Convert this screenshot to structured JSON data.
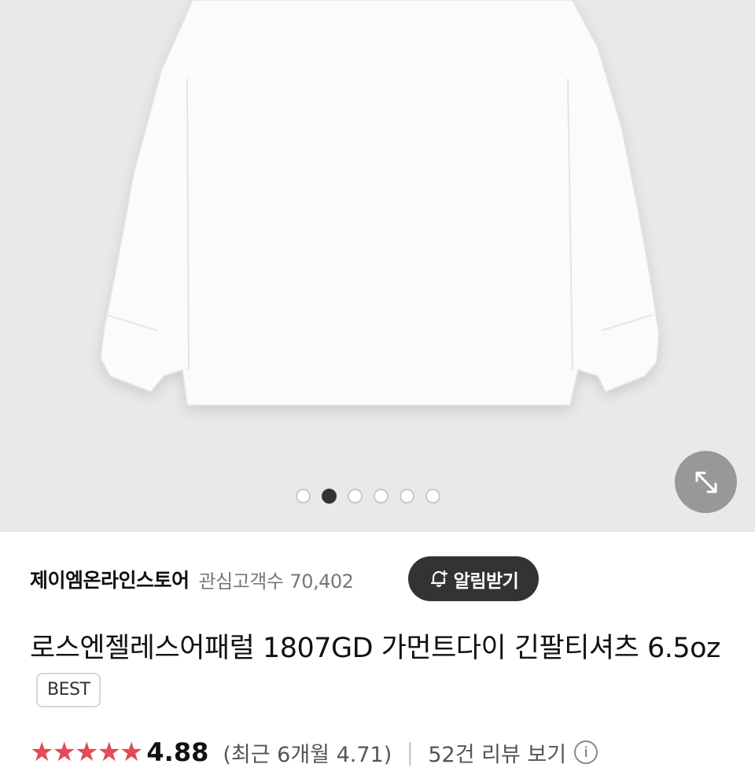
{
  "gallery": {
    "image_alt": "white long sleeve t-shirt",
    "dots_total": 6,
    "active_index": 1,
    "expand_icon": "expand-arrows-icon"
  },
  "store": {
    "name": "제이엠온라인스토어",
    "followers_label": "관심고객수",
    "followers_count": "70,402",
    "alert_button": "알림받기",
    "alert_icon": "bell-plus-icon"
  },
  "product": {
    "title": "로스엔젤레스어패럴 1807GD 가먼트다이 긴팔티셔츠 6.5oz",
    "badge": "BEST"
  },
  "rating": {
    "stars": "★★★★★",
    "score": "4.88",
    "recent": "(최근 6개월 4.71)",
    "separator": "|",
    "review_link": "52건 리뷰 보기",
    "info_icon": "info-icon"
  },
  "colors": {
    "hero_bg": "#e9e9ea",
    "alert_bg": "#333333",
    "star": "#e24a55"
  }
}
